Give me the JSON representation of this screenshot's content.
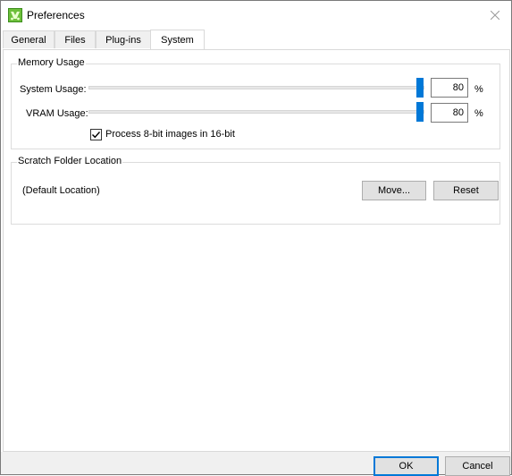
{
  "window": {
    "title": "Preferences"
  },
  "tabs": [
    {
      "label": "General",
      "active": false
    },
    {
      "label": "Files",
      "active": false
    },
    {
      "label": "Plug-ins",
      "active": false
    },
    {
      "label": "System",
      "active": true
    }
  ],
  "memory": {
    "group_title": "Memory Usage",
    "system_usage": {
      "label": "System Usage:",
      "value": "80",
      "unit": "%",
      "level": 0.8
    },
    "vram_usage": {
      "label": "VRAM Usage:",
      "value": "80",
      "unit": "%",
      "level": 0.8
    },
    "process_checkbox": {
      "label": "Process 8-bit images in 16-bit",
      "checked": true
    }
  },
  "scratch": {
    "group_title": "Scratch Folder Location",
    "location": "(Default Location)",
    "move_label": "Move...",
    "reset_label": "Reset"
  },
  "footer": {
    "ok_label": "OK",
    "cancel_label": "Cancel"
  },
  "colors": {
    "accent": "#0078d7",
    "icon_green": "#6cbf3a"
  }
}
